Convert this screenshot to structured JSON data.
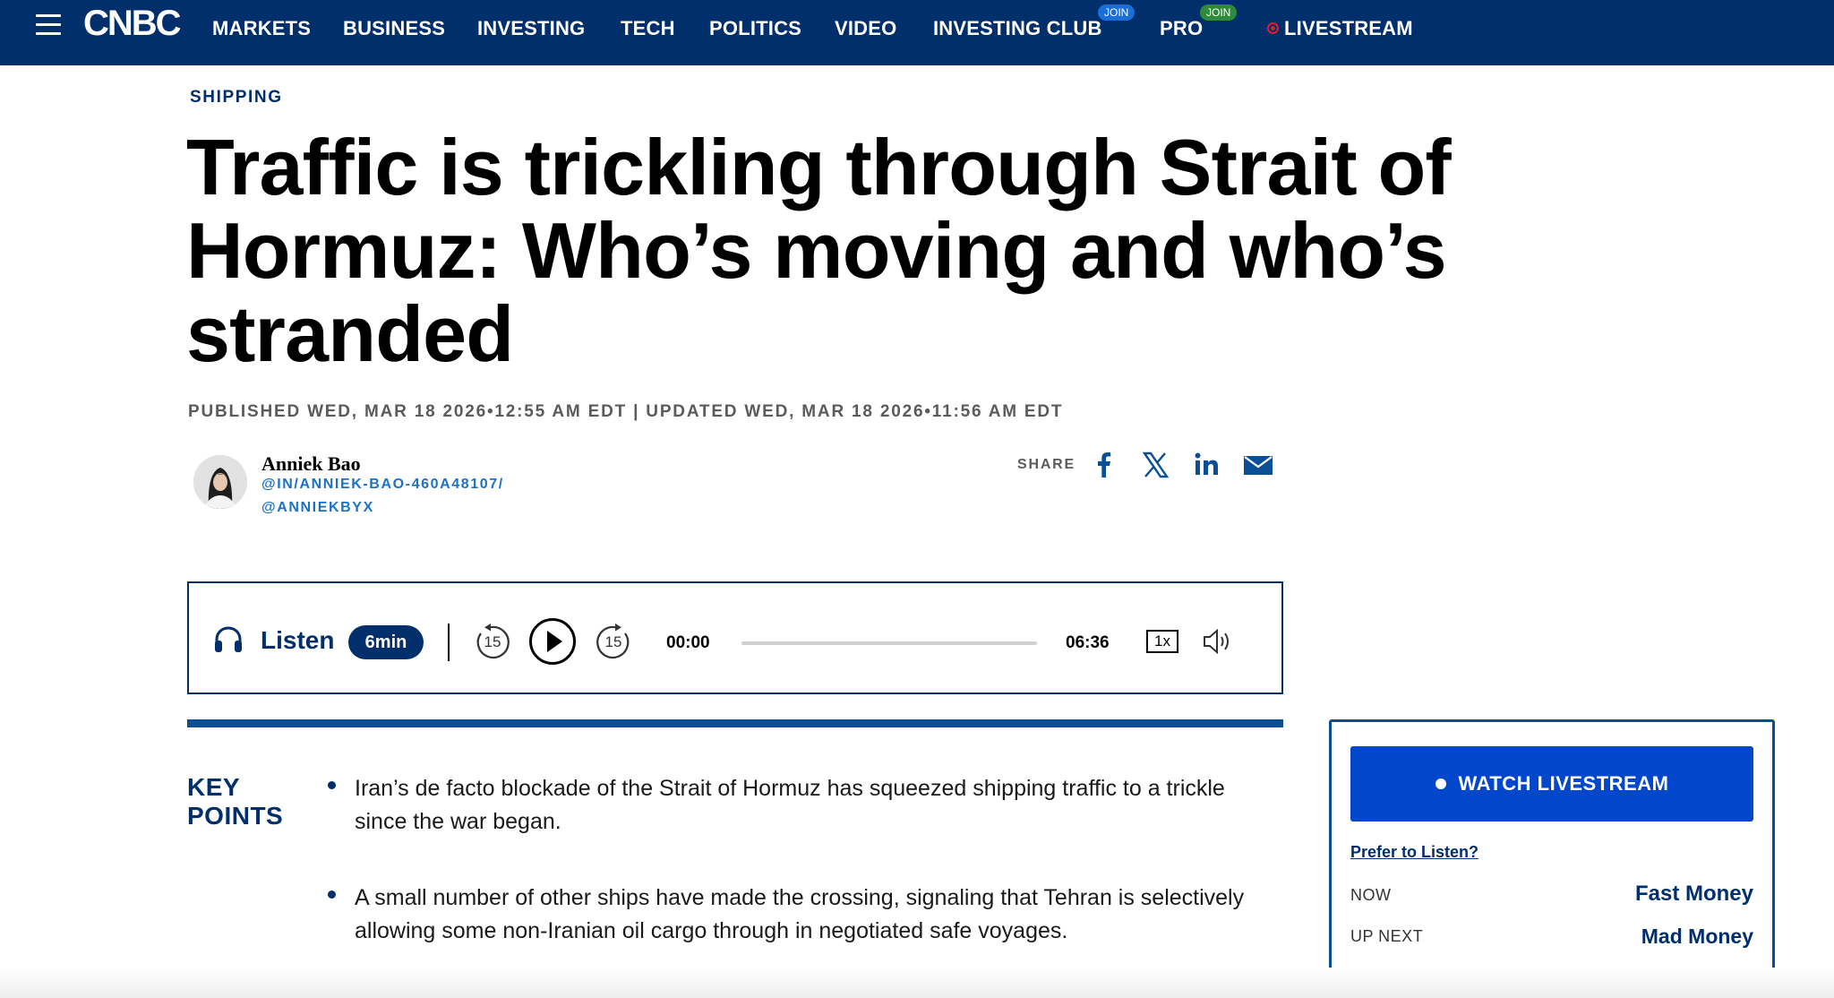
{
  "nav": {
    "logo": "CNBC",
    "items": [
      "MARKETS",
      "BUSINESS",
      "INVESTING",
      "TECH",
      "POLITICS",
      "VIDEO",
      "INVESTING CLUB",
      "PRO",
      "LIVESTREAM"
    ],
    "badges": {
      "investing_club": "JOIN",
      "pro": "JOIN"
    },
    "colors": {
      "bar": "#002f6c",
      "live": "#e21d2b"
    }
  },
  "article": {
    "section": "SHIPPING",
    "headline": "Traffic is trickling through Strait of Hormuz: Who’s moving and who’s stranded",
    "dateline": "PUBLISHED WED, MAR 18 2026•12:55 AM EDT | UPDATED WED, MAR 18 2026•11:56 AM EDT"
  },
  "author": {
    "name": "Anniek Bao",
    "links": [
      "@IN/ANNIEK-BAO-460A48107/",
      "@ANNIEKBYX"
    ]
  },
  "share": {
    "label": "SHARE",
    "icons": [
      "facebook-icon",
      "x-icon",
      "linkedin-icon",
      "email-icon"
    ]
  },
  "player": {
    "listen_label": "Listen",
    "duration_badge": "6min",
    "rewind_seconds": "15",
    "forward_seconds": "15",
    "current_time": "00:00",
    "total_time": "06:36",
    "speed": "1x",
    "progress": 0
  },
  "key_points": {
    "title": "KEY POINTS",
    "items": [
      "Iran’s de facto blockade of the Strait of Hormuz has squeezed shipping traffic to a trickle since the war began.",
      "A small number of other ships have made the crossing, signaling that Tehran is selectively allowing some non-Iranian oil cargo through in negotiated safe voyages."
    ]
  },
  "livestream": {
    "button": "WATCH LIVESTREAM",
    "prefer": "Prefer to Listen?",
    "now_label": "NOW",
    "now_show": "Fast Money",
    "next_label": "UP NEXT",
    "next_show": "Mad Money",
    "accent": "#0047cc"
  }
}
